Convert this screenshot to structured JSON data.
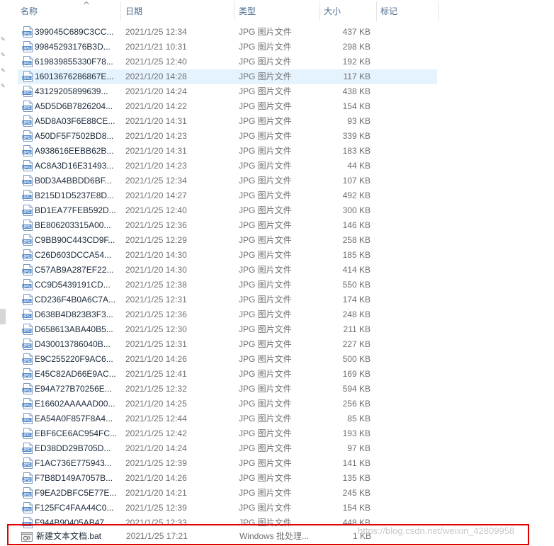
{
  "columns": {
    "name": "名称",
    "date": "日期",
    "type": "类型",
    "size": "大小",
    "tags": "标记"
  },
  "jpg_icon_text": "JPG",
  "files": [
    {
      "name": "399045C689C3CC...",
      "date": "2021/1/25 12:34",
      "type": "JPG 图片文件",
      "size": "437 KB"
    },
    {
      "name": "99845293176B3D...",
      "date": "2021/1/21 10:31",
      "type": "JPG 图片文件",
      "size": "298 KB"
    },
    {
      "name": "619839855330F78...",
      "date": "2021/1/25 12:40",
      "type": "JPG 图片文件",
      "size": "192 KB"
    },
    {
      "name": "16013676286867E...",
      "date": "2021/1/20 14:28",
      "type": "JPG 图片文件",
      "size": "117 KB",
      "selected": true
    },
    {
      "name": "43129205899639...",
      "date": "2021/1/20 14:24",
      "type": "JPG 图片文件",
      "size": "438 KB"
    },
    {
      "name": "A5D5D6B7826204...",
      "date": "2021/1/20 14:22",
      "type": "JPG 图片文件",
      "size": "154 KB"
    },
    {
      "name": "A5D8A03F6E88CE...",
      "date": "2021/1/20 14:31",
      "type": "JPG 图片文件",
      "size": "93 KB"
    },
    {
      "name": "A50DF5F7502BD8...",
      "date": "2021/1/20 14:23",
      "type": "JPG 图片文件",
      "size": "339 KB"
    },
    {
      "name": "A938616EEBB62B...",
      "date": "2021/1/20 14:31",
      "type": "JPG 图片文件",
      "size": "183 KB"
    },
    {
      "name": "AC8A3D16E31493...",
      "date": "2021/1/20 14:23",
      "type": "JPG 图片文件",
      "size": "44 KB"
    },
    {
      "name": "B0D3A4BBDD6BF...",
      "date": "2021/1/25 12:34",
      "type": "JPG 图片文件",
      "size": "107 KB"
    },
    {
      "name": "B215D1D5237E8D...",
      "date": "2021/1/20 14:27",
      "type": "JPG 图片文件",
      "size": "492 KB"
    },
    {
      "name": "BD1EA77FEB592D...",
      "date": "2021/1/25 12:40",
      "type": "JPG 图片文件",
      "size": "300 KB"
    },
    {
      "name": "BE806203315A00...",
      "date": "2021/1/25 12:36",
      "type": "JPG 图片文件",
      "size": "146 KB"
    },
    {
      "name": "C9BB90C443CD9F...",
      "date": "2021/1/25 12:29",
      "type": "JPG 图片文件",
      "size": "258 KB"
    },
    {
      "name": "C26D603DCCA54...",
      "date": "2021/1/20 14:30",
      "type": "JPG 图片文件",
      "size": "185 KB"
    },
    {
      "name": "C57AB9A287EF22...",
      "date": "2021/1/20 14:30",
      "type": "JPG 图片文件",
      "size": "414 KB"
    },
    {
      "name": "CC9D5439191CD...",
      "date": "2021/1/25 12:38",
      "type": "JPG 图片文件",
      "size": "550 KB"
    },
    {
      "name": "CD236F4B0A6C7A...",
      "date": "2021/1/25 12:31",
      "type": "JPG 图片文件",
      "size": "174 KB"
    },
    {
      "name": "D638B4D823B3F3...",
      "date": "2021/1/25 12:36",
      "type": "JPG 图片文件",
      "size": "248 KB"
    },
    {
      "name": "D658613ABA40B5...",
      "date": "2021/1/25 12:30",
      "type": "JPG 图片文件",
      "size": "211 KB"
    },
    {
      "name": "D430013786040B...",
      "date": "2021/1/25 12:31",
      "type": "JPG 图片文件",
      "size": "227 KB"
    },
    {
      "name": "E9C255220F9AC6...",
      "date": "2021/1/20 14:26",
      "type": "JPG 图片文件",
      "size": "500 KB"
    },
    {
      "name": "E45C82AD66E9AC...",
      "date": "2021/1/25 12:41",
      "type": "JPG 图片文件",
      "size": "169 KB"
    },
    {
      "name": "E94A727B70256E...",
      "date": "2021/1/25 12:32",
      "type": "JPG 图片文件",
      "size": "594 KB"
    },
    {
      "name": "E16602AAAAAD00...",
      "date": "2021/1/20 14:25",
      "type": "JPG 图片文件",
      "size": "256 KB"
    },
    {
      "name": "EA54A0F857F8A4...",
      "date": "2021/1/25 12:44",
      "type": "JPG 图片文件",
      "size": "85 KB"
    },
    {
      "name": "EBF6CE6AC954FC...",
      "date": "2021/1/25 12:42",
      "type": "JPG 图片文件",
      "size": "193 KB"
    },
    {
      "name": "ED38DD29B705D...",
      "date": "2021/1/20 14:24",
      "type": "JPG 图片文件",
      "size": "97 KB"
    },
    {
      "name": "F1AC736E775943...",
      "date": "2021/1/25 12:39",
      "type": "JPG 图片文件",
      "size": "141 KB"
    },
    {
      "name": "F7B8D149A7057B...",
      "date": "2021/1/20 14:26",
      "type": "JPG 图片文件",
      "size": "135 KB"
    },
    {
      "name": "F9EA2DBFC5E77E...",
      "date": "2021/1/20 14:21",
      "type": "JPG 图片文件",
      "size": "245 KB"
    },
    {
      "name": "F125FC4FAA44C0...",
      "date": "2021/1/25 12:39",
      "type": "JPG 图片文件",
      "size": "154 KB"
    },
    {
      "name": "F944B90405AB47...",
      "date": "2021/1/25 12:33",
      "type": "JPG 图片文件",
      "size": "448 KB"
    }
  ],
  "bat_file": {
    "name": "新建文本文档.bat",
    "date": "2021/1/25 17:21",
    "type": "Windows 批处理...",
    "size": "1 KB"
  },
  "watermark": "https://blog.csdn.net/weixin_42809958",
  "colors": {
    "selected_row": "#e5f3ff",
    "highlight_box": "#e00000",
    "header_text": "#4d6c8f"
  }
}
